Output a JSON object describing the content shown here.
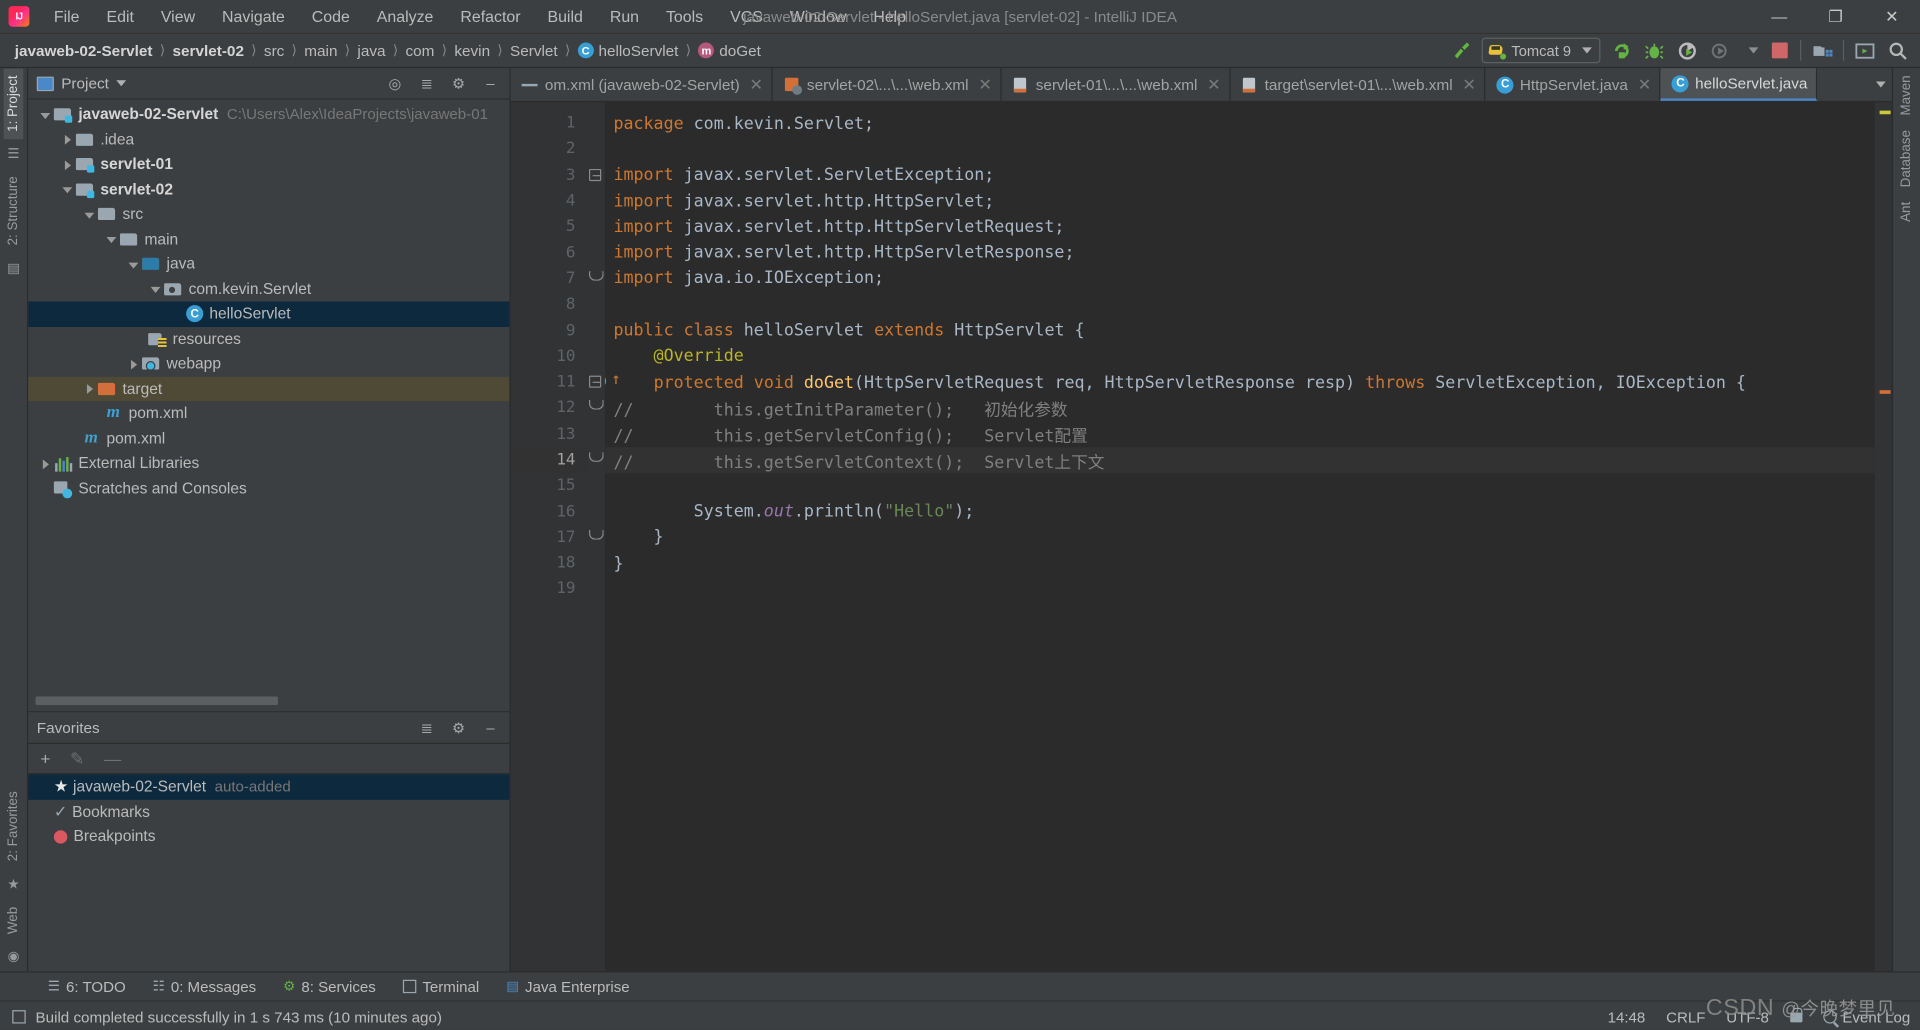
{
  "window": {
    "title": "javaweb-02-Servlet - helloServlet.java [servlet-02] - IntelliJ IDEA",
    "minimize": "—",
    "maximize": "❐",
    "close": "✕"
  },
  "menu": {
    "items": [
      {
        "label": "File"
      },
      {
        "label": "Edit"
      },
      {
        "label": "View"
      },
      {
        "label": "Navigate"
      },
      {
        "label": "Code"
      },
      {
        "label": "Analyze"
      },
      {
        "label": "Refactor"
      },
      {
        "label": "Build"
      },
      {
        "label": "Run"
      },
      {
        "label": "Tools"
      },
      {
        "label": "VCS"
      },
      {
        "label": "Window"
      },
      {
        "label": "Help"
      }
    ]
  },
  "breadcrumb": {
    "items": [
      {
        "label": "javaweb-02-Servlet",
        "bold": true
      },
      {
        "label": "servlet-02",
        "bold": true
      },
      {
        "label": "src"
      },
      {
        "label": "main"
      },
      {
        "label": "java"
      },
      {
        "label": "com"
      },
      {
        "label": "kevin"
      },
      {
        "label": "Servlet"
      },
      {
        "label": "helloServlet",
        "badge": "C"
      },
      {
        "label": "doGet",
        "badge": "m"
      }
    ]
  },
  "toolbar": {
    "build_hammer": "build-icon",
    "run_config_label": "Tomcat 9",
    "run_label": "run-icon",
    "debug_label": "debug-icon",
    "run_coverage_label": "run-with-coverage-icon",
    "profile_label": "profiler-icon",
    "stop_label": "stop-icon",
    "update_label": "update-app-icon",
    "settings_label": "ide-settings-icon",
    "search_label": "search-everywhere-icon"
  },
  "left_strip": {
    "project_tab": "1: Project",
    "structure_tab": "2: Structure",
    "favorites_tab": "2: Favorites",
    "web_tab": "Web"
  },
  "right_strip": {
    "maven_tab": "Maven",
    "database_tab": "Database",
    "ant_tab": "Ant"
  },
  "project_panel": {
    "title": "Project",
    "tree": [
      {
        "depth": 0,
        "arrow": "d",
        "icon": "mod",
        "label": "javaweb-02-Servlet",
        "bold": true,
        "path": "C:\\Users\\Alex\\IdeaProjects\\javaweb-01"
      },
      {
        "depth": 1,
        "arrow": "r",
        "icon": "plain",
        "label": ".idea"
      },
      {
        "depth": 1,
        "arrow": "r",
        "icon": "mod",
        "label": "servlet-01",
        "bold": true
      },
      {
        "depth": 1,
        "arrow": "d",
        "icon": "mod",
        "label": "servlet-02",
        "bold": true
      },
      {
        "depth": 2,
        "arrow": "d",
        "icon": "plain",
        "label": "src"
      },
      {
        "depth": 3,
        "arrow": "d",
        "icon": "plain",
        "label": "main"
      },
      {
        "depth": 4,
        "arrow": "d",
        "icon": "src",
        "label": "java"
      },
      {
        "depth": 5,
        "arrow": "d",
        "icon": "pkg",
        "label": "com.kevin.Servlet"
      },
      {
        "depth": 6,
        "arrow": "",
        "icon": "cls",
        "label": "helloServlet",
        "state": "sel"
      },
      {
        "depth": 4,
        "arrow": "",
        "icon": "res",
        "label": "resources"
      },
      {
        "depth": 4,
        "arrow": "r",
        "icon": "web",
        "label": "webapp"
      },
      {
        "depth": 2,
        "arrow": "r",
        "icon": "tgt",
        "label": "target",
        "state": "hl"
      },
      {
        "depth": 3,
        "arrow": "",
        "icon": "mvn",
        "label": "pom.xml"
      },
      {
        "depth": 2,
        "arrow": "",
        "icon": "mvn",
        "label": "pom.xml"
      },
      {
        "depth": 0,
        "arrow": "r",
        "icon": "libs",
        "label": "External Libraries"
      },
      {
        "depth": 0,
        "arrow": "",
        "icon": "scr",
        "label": "Scratches and Consoles"
      }
    ]
  },
  "favorites_panel": {
    "title": "Favorites",
    "add_label": "+",
    "edit_label": "✎",
    "remove_label": "—",
    "items": [
      {
        "icon": "star",
        "label": "javaweb-02-Servlet",
        "note": "auto-added",
        "state": "sel"
      },
      {
        "icon": "check",
        "label": "Bookmarks"
      },
      {
        "icon": "dot",
        "label": "Breakpoints"
      }
    ]
  },
  "editor_tabs": [
    {
      "label": "om.xml (javaweb-02-Servlet)",
      "icon": "dash",
      "active": false,
      "close": "✕"
    },
    {
      "label": "servlet-02\\...\\...\\web.xml",
      "icon": "xml2",
      "active": false,
      "close": "✕"
    },
    {
      "label": "servlet-01\\...\\...\\web.xml",
      "icon": "xml",
      "active": false,
      "close": "✕"
    },
    {
      "label": "target\\servlet-01\\...\\web.xml",
      "icon": "xml",
      "active": false,
      "close": "✕"
    },
    {
      "label": "HttpServlet.java",
      "icon": "java",
      "badge": "C",
      "active": false,
      "close": "✕"
    },
    {
      "label": "helloServlet.java",
      "icon": "java",
      "badge": "C",
      "active": true,
      "close": ""
    }
  ],
  "code": {
    "lines": [
      {
        "n": "1",
        "tokens": [
          {
            "t": "package ",
            "c": "kw"
          },
          {
            "t": "com.kevin.Servlet;",
            "c": "ident"
          }
        ]
      },
      {
        "n": "2",
        "tokens": []
      },
      {
        "n": "3",
        "fold": "box",
        "tokens": [
          {
            "t": "import ",
            "c": "kw"
          },
          {
            "t": "javax.servlet.ServletException;",
            "c": "ident"
          }
        ]
      },
      {
        "n": "4",
        "tokens": [
          {
            "t": "import ",
            "c": "kw"
          },
          {
            "t": "javax.servlet.http.HttpServlet;",
            "c": "ident"
          }
        ]
      },
      {
        "n": "5",
        "tokens": [
          {
            "t": "import ",
            "c": "kw"
          },
          {
            "t": "javax.servlet.http.HttpServletRequest;",
            "c": "ident"
          }
        ]
      },
      {
        "n": "6",
        "tokens": [
          {
            "t": "import ",
            "c": "kw"
          },
          {
            "t": "javax.servlet.http.HttpServletResponse;",
            "c": "ident"
          }
        ]
      },
      {
        "n": "7",
        "fold": "tri",
        "tokens": [
          {
            "t": "import ",
            "c": "kw"
          },
          {
            "t": "java.io.IOException;",
            "c": "ident"
          }
        ]
      },
      {
        "n": "8",
        "tokens": []
      },
      {
        "n": "9",
        "tokens": [
          {
            "t": "public class ",
            "c": "kw"
          },
          {
            "t": "helloServlet ",
            "c": "ident"
          },
          {
            "t": "extends ",
            "c": "kw"
          },
          {
            "t": "HttpServlet {",
            "c": "ident"
          }
        ]
      },
      {
        "n": "10",
        "tokens": [
          {
            "t": "    @Override",
            "c": "ann"
          }
        ]
      },
      {
        "n": "11",
        "fold": "box",
        "marker": "override",
        "tokens": [
          {
            "t": "    ",
            "c": "ident"
          },
          {
            "t": "protected void ",
            "c": "kw"
          },
          {
            "t": "doGet",
            "c": "mth"
          },
          {
            "t": "(HttpServletRequest req, HttpServletResponse resp) ",
            "c": "ident"
          },
          {
            "t": "throws ",
            "c": "kw"
          },
          {
            "t": "ServletException, IOException {",
            "c": "ident"
          }
        ]
      },
      {
        "n": "12",
        "fold": "tri",
        "tokens": [
          {
            "t": "//        this.getInitParameter();   初始化参数",
            "c": "cmt"
          }
        ]
      },
      {
        "n": "13",
        "tokens": [
          {
            "t": "//        this.getServletConfig();   Servlet配置",
            "c": "cmt"
          }
        ]
      },
      {
        "n": "14",
        "cur": true,
        "fold": "tri",
        "tokens": [
          {
            "t": "//        this.getServletContext();  Servlet上下文",
            "c": "cmt"
          }
        ]
      },
      {
        "n": "15",
        "tokens": []
      },
      {
        "n": "16",
        "tokens": [
          {
            "t": "        System.",
            "c": "ident"
          },
          {
            "t": "out",
            "c": "fld"
          },
          {
            "t": ".println(",
            "c": "ident"
          },
          {
            "t": "\"Hello\"",
            "c": "str"
          },
          {
            "t": ");",
            "c": "ident"
          }
        ]
      },
      {
        "n": "17",
        "fold": "tri",
        "tokens": [
          {
            "t": "    }",
            "c": "ident"
          }
        ]
      },
      {
        "n": "18",
        "tokens": [
          {
            "t": "}",
            "c": "ident"
          }
        ]
      },
      {
        "n": "19",
        "tokens": []
      }
    ]
  },
  "tool_windows": [
    {
      "label": "6: TODO",
      "icon": "list"
    },
    {
      "label": "0: Messages",
      "icon": "msg"
    },
    {
      "label": "8: Services",
      "icon": "svc"
    },
    {
      "label": "Terminal",
      "icon": "term"
    },
    {
      "label": "Java Enterprise",
      "icon": "jee"
    }
  ],
  "status": {
    "message": "Build completed successfully in 1 s 743 ms (10 minutes ago)",
    "time": "14:48",
    "line_sep": "CRLF",
    "encoding": "UTF-8",
    "event_log": "Event Log",
    "watermark_main": "CSDN",
    "watermark_cn": "@今晚梦里见"
  }
}
